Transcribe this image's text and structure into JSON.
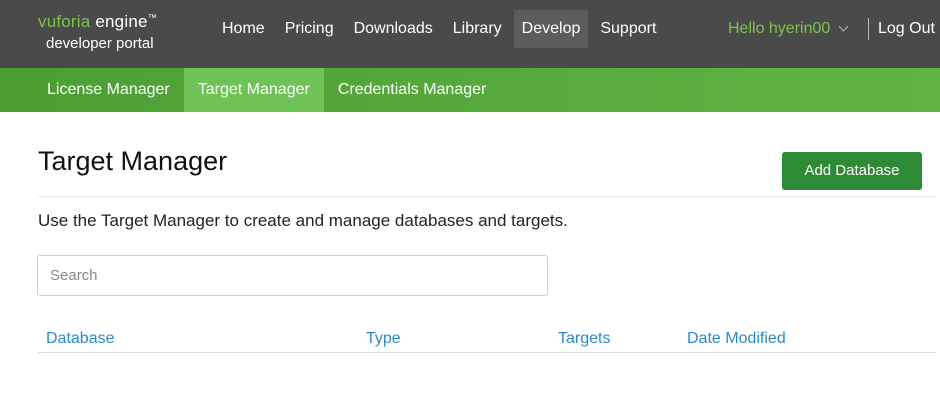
{
  "logo": {
    "brand": "vuforia",
    "product": "engine",
    "tm": "™",
    "subtitle": "developer portal"
  },
  "nav": {
    "items": [
      {
        "label": "Home"
      },
      {
        "label": "Pricing"
      },
      {
        "label": "Downloads"
      },
      {
        "label": "Library"
      },
      {
        "label": "Develop",
        "active": true
      },
      {
        "label": "Support"
      }
    ]
  },
  "user": {
    "greeting": "Hello hyerin00",
    "logout_label": "Log Out"
  },
  "subnav": {
    "items": [
      {
        "label": "License Manager"
      },
      {
        "label": "Target Manager",
        "active": true
      },
      {
        "label": "Credentials Manager"
      }
    ]
  },
  "main": {
    "title": "Target Manager",
    "add_button_label": "Add Database",
    "description": "Use the Target Manager to create and manage databases and targets.",
    "search": {
      "placeholder": "Search",
      "value": ""
    },
    "table": {
      "columns": [
        "Database",
        "Type",
        "Targets",
        "Date Modified"
      ]
    }
  },
  "colors": {
    "topbar": "#4a4a4a",
    "subnav": "#55a83b",
    "brand_green": "#7fc34b",
    "button_green": "#2f8a35",
    "link_blue": "#2a8bc4"
  }
}
